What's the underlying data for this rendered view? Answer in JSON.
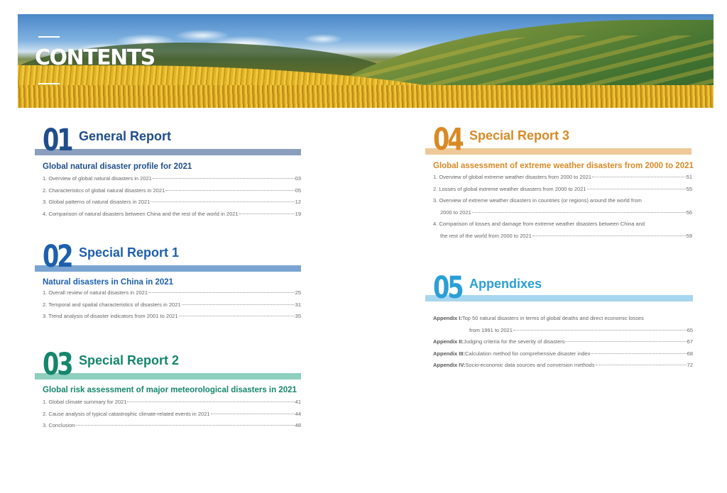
{
  "banner": {
    "title": "CONTENTS"
  },
  "sections": [
    {
      "number": "01",
      "title": "General Report",
      "subtitle": "Global natural disaster profile for 2021",
      "items": [
        {
          "text": "1. Overview of global natural disasters in 2021",
          "page": "03"
        },
        {
          "text": "2. Characteristics of global natural disasters in 2021",
          "page": "05"
        },
        {
          "text": "3. Global patterns of natural disasters in 2021",
          "page": "12"
        },
        {
          "text": "4. Comparison of natural disasters between China and the rest of the world in 2021",
          "page": "19"
        }
      ]
    },
    {
      "number": "02",
      "title": "Special Report 1",
      "subtitle": "Natural disasters in China in 2021",
      "items": [
        {
          "text": "1. Overall review of natural disasters in 2021",
          "page": "25"
        },
        {
          "text": "2. Temporal and spatial characteristics of disasters in 2021",
          "page": "31"
        },
        {
          "text": "3. Trend analysis of disaster indicators from 2001 to 2021",
          "page": "35"
        }
      ]
    },
    {
      "number": "03",
      "title": "Special Report 2",
      "subtitle": "Global risk assessment of major meteorological disasters in 2021",
      "items": [
        {
          "text": "1. Global climate summary for 2021",
          "page": "41"
        },
        {
          "text": "2. Cause analysis of typical catastrophic climate-related events in 2021",
          "page": "44"
        },
        {
          "text": "3. Conclusion",
          "page": "48"
        }
      ]
    },
    {
      "number": "04",
      "title": "Special Report 3",
      "subtitle": "Global assessment of extreme weather disasters from 2000 to 2021",
      "items": [
        {
          "text": "1. Overview of global extreme weather disasters from 2000 to 2021",
          "page": "51"
        },
        {
          "text": "2. Losses of global extreme weather disasters from 2000 to 2021",
          "page": "55"
        },
        {
          "text": "3. Overview of extreme weather disasters in countries (or regions) around the world from",
          "cont": "2000 to 2021",
          "page": "56"
        },
        {
          "text": "4. Comparison of losses and damage from extreme weather disasters between China and",
          "cont": "the rest of the world from 2000 to 2021",
          "page": "59"
        }
      ]
    },
    {
      "number": "05",
      "title": "Appendixes",
      "items": [
        {
          "label": "Appendix I:",
          "text": "Top 50 natural disasters in terms of global deaths and direct economic losses",
          "cont": "from 1991 to 2021",
          "page": "65"
        },
        {
          "label": "Appendix II:",
          "text": "Judging criteria for the severity of disasters",
          "page": "67"
        },
        {
          "label": "Appendix III:",
          "text": "Calculation method for comprehensive disaster index",
          "page": "68"
        },
        {
          "label": "Appendix IV:",
          "text": "Socio-economic data sources and conversion methods",
          "page": "72"
        }
      ]
    }
  ]
}
